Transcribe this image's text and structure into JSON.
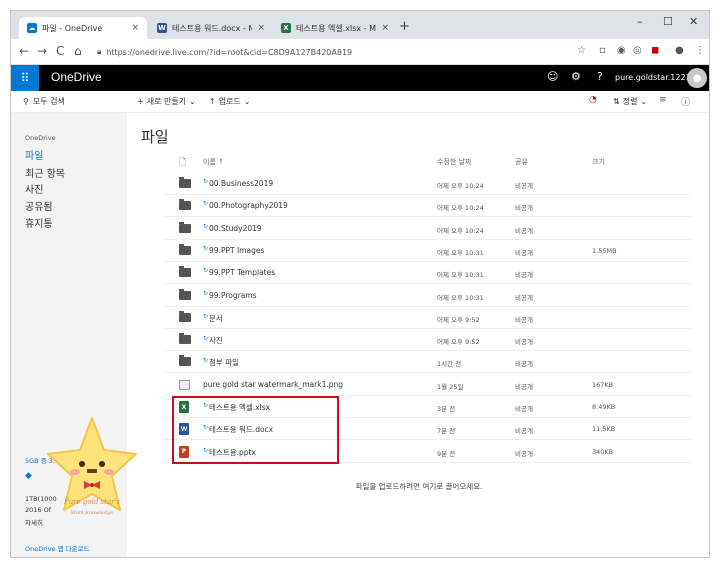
{
  "browser": {
    "tabs": [
      {
        "label": "파일 - OneDrive",
        "icon": "onedrive-icon",
        "color": "#0078d4"
      },
      {
        "label": "테스트용 워드.docx - Microsoft",
        "icon": "word-icon",
        "color": "#2b579a"
      },
      {
        "label": "테스트용 엑셀.xlsx - Microsoft E",
        "icon": "excel-icon",
        "color": "#217346"
      }
    ],
    "url": "https://onedrive.live.com/?id=root&cid=C8D9A127B420A819"
  },
  "header": {
    "brand": "OneDrive",
    "username": "pure.goldstar.1221..."
  },
  "commandbar": {
    "search": "모두 검색",
    "new": "새로 만들기",
    "upload": "업로드",
    "sort": "정렬"
  },
  "sidebar": {
    "breadcrumb": "OneDrive",
    "items": [
      "파일",
      "최근 항목",
      "사진",
      "공유됨",
      "휴지통"
    ],
    "storage_used": "5GB 중 3.0",
    "storage_lines": [
      "1TB(1000",
      "2016 Of",
      "자세히"
    ],
    "download_link": "OneDrive 앱 다운로드"
  },
  "main": {
    "title": "파일",
    "columns": {
      "name": "이름 ↑",
      "modified": "수정한 날짜",
      "sharing": "공유",
      "size": "크기"
    },
    "files": [
      {
        "name": "00.Business2019",
        "modified": "어제 오후 10:24",
        "sharing": "비공개",
        "size": "",
        "kind": "folder",
        "sync": true
      },
      {
        "name": "00.Photography2019",
        "modified": "어제 오후 10:24",
        "sharing": "비공개",
        "size": "",
        "kind": "folder",
        "sync": true
      },
      {
        "name": "00.Study2019",
        "modified": "어제 오후 10:24",
        "sharing": "비공개",
        "size": "",
        "kind": "folder",
        "sync": true
      },
      {
        "name": "99.PPT Images",
        "modified": "어제 오후 10:31",
        "sharing": "비공개",
        "size": "1.55MB",
        "kind": "folder",
        "sync": true
      },
      {
        "name": "99.PPT Templates",
        "modified": "어제 오후 10:31",
        "sharing": "비공개",
        "size": "",
        "kind": "folder",
        "sync": true
      },
      {
        "name": "99.Programs",
        "modified": "어제 오후 10:31",
        "sharing": "비공개",
        "size": "",
        "kind": "folder",
        "sync": true
      },
      {
        "name": "문서",
        "modified": "어제 오후 9:52",
        "sharing": "비공개",
        "size": "",
        "kind": "folder",
        "sync": true
      },
      {
        "name": "사진",
        "modified": "어제 오후 9:52",
        "sharing": "비공개",
        "size": "",
        "kind": "folder",
        "sync": true
      },
      {
        "name": "첨부 파일",
        "modified": "1시간 전",
        "sharing": "비공개",
        "size": "",
        "kind": "folder",
        "sync": true
      },
      {
        "name": "pure gold star watermark_mark1.png",
        "modified": "1월 25일",
        "sharing": "비공개",
        "size": "167KB",
        "kind": "image",
        "sync": false
      },
      {
        "name": "테스트용 엑셀.xlsx",
        "modified": "3분 전",
        "sharing": "비공개",
        "size": "8.49KB",
        "kind": "excel",
        "sync": true
      },
      {
        "name": "테스트용 워드.docx",
        "modified": "7분 전",
        "sharing": "비공개",
        "size": "11.5KB",
        "kind": "word",
        "sync": true
      },
      {
        "name": "테스트용.pptx",
        "modified": "9분 전",
        "sharing": "비공개",
        "size": "340KB",
        "kind": "powerpoint",
        "sync": true
      }
    ],
    "upload_hint": "파일을 업로드하려면 여기로 끌어오세요.",
    "highlight_color": "#c0131a"
  },
  "watermark": {
    "line1": "Pure gold star's",
    "line2": "Work knowledge"
  }
}
